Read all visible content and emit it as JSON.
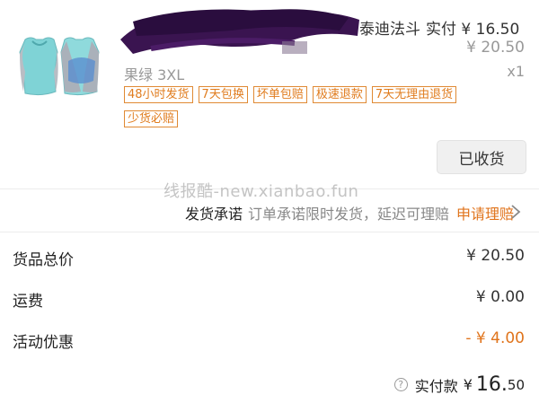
{
  "product": {
    "title_visible": "泰迪法斗",
    "paid_label": "实付",
    "paid_price": "¥ 16.50",
    "original_price": "¥ 20.50",
    "variant": "果绿 3XL",
    "quantity": "x1",
    "tags": [
      "48小时发货",
      "7天包换",
      "坏单包赔",
      "极速退款",
      "7天无理由退货",
      "少货必赔"
    ],
    "received_button": "已收货"
  },
  "watermark": "线报酷-new.xianbao.fun",
  "promise": {
    "title": "发货承诺",
    "desc": "订单承诺限时发货，延迟可理赔",
    "link": "申请理赔"
  },
  "summary": {
    "rows": [
      {
        "label": "货品总价",
        "value": "¥ 20.50"
      },
      {
        "label": "运费",
        "value": "¥ 0.00"
      },
      {
        "label": "活动优惠",
        "value": "- ¥ 4.00"
      }
    ],
    "paid_label": "实付款",
    "paid_currency": "¥",
    "paid_int": "16.",
    "paid_dec": "50"
  },
  "colors": {
    "accent": "#e0741c",
    "tag_border": "#e08a34",
    "muted": "#999999"
  }
}
